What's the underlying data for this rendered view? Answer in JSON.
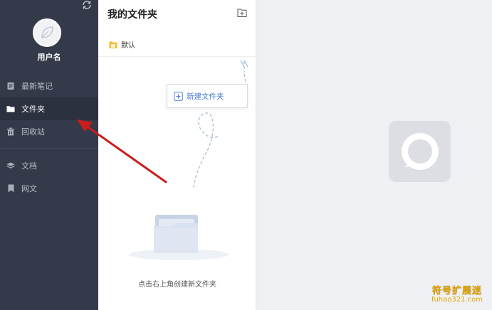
{
  "sidebar": {
    "username": "用户名",
    "items": [
      {
        "label": "最新笔记",
        "icon": "note-icon"
      },
      {
        "label": "文件夹",
        "icon": "folder-icon"
      },
      {
        "label": "回收站",
        "icon": "trash-icon"
      },
      {
        "label": "文档",
        "icon": "layers-icon"
      },
      {
        "label": "网文",
        "icon": "bookmark-icon"
      }
    ],
    "active_index": 1
  },
  "panel": {
    "title": "我的文件夹",
    "default_folder": "默认",
    "new_folder_label": "新建文件夹",
    "empty_hint": "点击右上角创建新文件夹"
  },
  "watermark": {
    "title": "符号扩展迷",
    "url": "fuhao321.com"
  },
  "colors": {
    "sidebar_bg": "#353a4a",
    "sidebar_active": "#2c3140",
    "accent_blue": "#4a7ad6",
    "annotation_red": "#c81d1d",
    "watermark": "#e6a600"
  }
}
